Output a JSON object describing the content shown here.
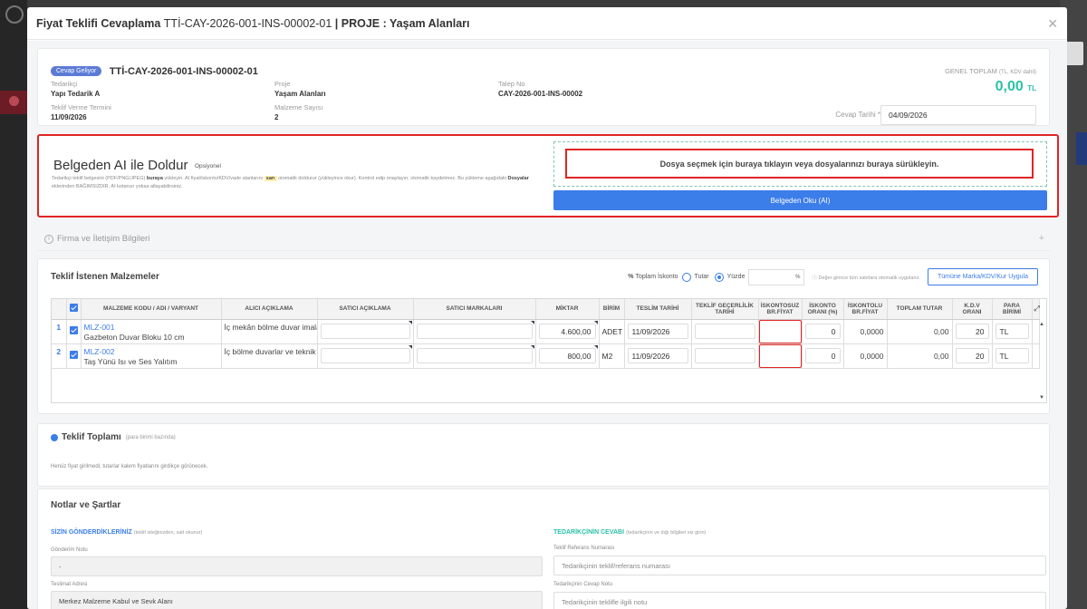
{
  "modal": {
    "title_prefix": "Fiyat Teklifi Cevaplama ",
    "title_code": "TTİ-CAY-2026-001-INS-00002-01",
    "title_suffix": " | PROJE : Yaşam Alanları"
  },
  "info": {
    "badge": "Cevap Geliyor",
    "code": "TTİ-CAY-2026-001-INS-00002-01",
    "supplier_label": "Tedarikçi",
    "supplier": "Yapı Tedarik A",
    "project_label": "Proje",
    "project": "Yaşam Alanları",
    "request_label": "Talep No",
    "request": "CAY-2026-001-INS-00002",
    "deadline_label": "Teklif Verme Termini",
    "deadline": "11/09/2026",
    "material_count_label": "Malzeme Sayısı",
    "material_count": "2",
    "total_label": "GENEL TOPLAM",
    "total_label_note": "(TL, KDV dahil)",
    "total_value": "0,00",
    "total_currency": "TL",
    "reply_date_label": "Cevap Tarihi *",
    "reply_date": "04/09/2026"
  },
  "ai": {
    "title": "Belgeden AI ile Doldur",
    "optional": "Opsiyonel",
    "desc_1": "Tedarikçi teklif belgesini (PDF/PNG/JPEG) ",
    "desc_2": "buraya",
    "desc_3": " yükleyin. AI fiyat/iskonto/KDV/vade alanlarını ",
    "desc_4": "sarı",
    "desc_5": " otomatik doldurur (yükleyince okur). Kontrol edip onaylayın; otomatik kaydetmez. Bu yükleme aşağıdaki ",
    "desc_6": "Dosyalar",
    "desc_7": " eklerinden BAĞIMSIZDIR. AI kotanızı yoksa atlayabilirsiniz.",
    "drop_text": "Dosya seçmek için buraya tıklayın veya dosyalarınızı buraya sürükleyin.",
    "read_button": "Belgeden Oku (AI)"
  },
  "contact_section": "Firma ve İletişim Bilgileri",
  "materials": {
    "title": "Teklif İstenen Malzemeler",
    "discount_label": "Toplam İskonto",
    "amount_label": "Tutar",
    "percent_label": "Yüzde",
    "percent_unit": "%",
    "hint": "Değer girince tüm satırlara otomatik uygulanır.",
    "apply_button": "Tümüne Marka/KDV/Kur Uygula",
    "columns": [
      "MALZEME KODU / ADI / VARYANT",
      "ALICI AÇIKLAMA",
      "SATICI AÇIKLAMA",
      "SATICI MARKALARI",
      "MİKTAR",
      "BİRİM",
      "TESLİM TARİHİ",
      "TEKLİF GEÇERLİLİK TARİHİ",
      "İSKONTOSUZ BR.FİYAT",
      "İSKONTO ORANI (%)",
      "İSKONTOLU BR.FİYAT",
      "TOPLAM TUTAR",
      "K.D.V ORANI",
      "PARA BİRİMİ"
    ],
    "rows": [
      {
        "num": "1",
        "code": "MLZ-001",
        "name": "Gazbeton Duvar Bloku 10 cm",
        "desc": "İç mekân bölme duvar imalatlarında",
        "qty": "4.600,00",
        "unit": "ADET",
        "delivery": "11/09/2026",
        "disc_rate": "0",
        "disc_price": "0,0000",
        "total": "0,00",
        "vat": "20",
        "currency": "TL"
      },
      {
        "num": "2",
        "code": "MLZ-002",
        "name": "Taş Yünü Isı ve Ses Yalıtım",
        "desc": "İç bölme duvarlar ve teknik hacimlerde ısı ve",
        "qty": "800,00",
        "unit": "M2",
        "delivery": "11/09/2026",
        "disc_rate": "0",
        "disc_price": "0,0000",
        "total": "0,00",
        "vat": "20",
        "currency": "TL"
      }
    ]
  },
  "totals": {
    "title": "Teklif Toplamı",
    "sub": "(para birimi bazında)",
    "note": "Henüz fiyat girilmedi; tutarlar kalem fiyatlarını girdikçe görünecek."
  },
  "notes": {
    "title": "Notlar ve Şartlar",
    "yours": "SİZİN GÖNDERDİKLERİNİZ",
    "yours_sub": "(teklif isteğinizden, salt okunur)",
    "send_note_label": "Gönderim Notu",
    "send_note": "-",
    "delivery_addr_label": "Teslimat Adresi",
    "delivery_addr": "Merkez Malzeme Kabul ve Sevk Alanı",
    "supplier_reply": "TEDARİKÇİNİN CEVABI",
    "supplier_reply_sub": "(tedarikçinin ve dığı bilgileri siz girin)",
    "ref_label": "Teklif Referans Numarası",
    "ref_placeholder": "Tedarikçinin teklif/referans numarası",
    "reply_note_label": "Tedarikçinin Cevap Notu",
    "reply_note_placeholder": "Tedarikçinin teklifle ilgili notu"
  },
  "colors": {
    "accent": "#3b7de9",
    "highlight": "#e02424",
    "total": "#2cc1a6"
  }
}
